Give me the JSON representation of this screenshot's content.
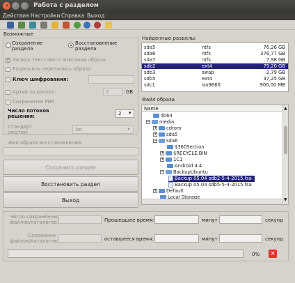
{
  "window": {
    "title": "Работа с разделом"
  },
  "menu": [
    "Действия",
    "Настройки",
    "Справка",
    "Выход"
  ],
  "toolbar_icons": [
    "save-icon",
    "open-icon",
    "refresh-icon",
    "disk-icon",
    "folder-icon",
    "home-icon",
    "globe-icon",
    "info-icon",
    "exit-icon",
    "pencil-icon"
  ],
  "options": {
    "section_title": "Возможные",
    "radio_save": "Сохранение раздела",
    "radio_save_l1": "Сохранение",
    "radio_save_l2": "раздела",
    "radio_restore_l1": "Восстановление",
    "radio_restore_l2": "раздела",
    "write_desc": "Запись текстового описания образа",
    "allow_overwrite": "Разрешить перезапись образа",
    "encrypt_key": "Ключ шифрования:",
    "archive_split": "Архив за раскол:",
    "split_value": "2",
    "split_unit": "GB",
    "save_pbr": "Сохранение PBR",
    "threads_l1": "Число потоков",
    "threads_l2": "решения:",
    "threads_value": "2",
    "compress_l1": "Стандарт",
    "compress_l2": "сжатия:",
    "compress_value": "lzo",
    "image_name_label": "Имя образа восстановления:"
  },
  "buttons": {
    "save": "Сохранить раздел",
    "restore": "Восстановить раздел",
    "exit": "Выход"
  },
  "partitions": {
    "title": "Найденные разделы:",
    "rows": [
      {
        "name": "sda5",
        "fs": "ntfs",
        "size": "76,26 GB"
      },
      {
        "name": "sda6",
        "fs": "ntfs",
        "size": "376,77 GB"
      },
      {
        "name": "sda7",
        "fs": "ntfs",
        "size": "7,98 GB"
      },
      {
        "name": "sdb2",
        "fs": "ext4",
        "size": "79,20 GB"
      },
      {
        "name": "sdb3",
        "fs": "swap",
        "size": "2,79 GB"
      },
      {
        "name": "sdb5",
        "fs": "ext4",
        "size": "37,25 GB"
      },
      {
        "name": "sdc1",
        "fs": "iso9660",
        "size": "900,00 MB"
      }
    ],
    "selected": "sdb2"
  },
  "files": {
    "title": "Файл образа",
    "column": "Name",
    "rows": [
      {
        "label": "lib64"
      },
      {
        "label": "media"
      },
      {
        "label": "cdrom"
      },
      {
        "label": "sda5"
      },
      {
        "label": "sda6"
      },
      {
        "label": "$360Section"
      },
      {
        "label": "$RECYCLE.BIN"
      },
      {
        "label": "1C1"
      },
      {
        "label": "Android 4.4"
      },
      {
        "label": "BackupUbuntu"
      },
      {
        "label": "Backup 05.04 sdb2-5-4-2015.fsa"
      },
      {
        "label": "Backup 05.04 sdb5-5-4-2015.fsa"
      },
      {
        "label": "Default"
      },
      {
        "label": "Local Storage"
      }
    ]
  },
  "status": {
    "saved_files_l1": "Число сохранённых",
    "saved_files_l2": "файлов/каталогов:",
    "restored_l1": "Сохранено",
    "restored_l2": "файлов/каталогов:",
    "elapsed": "Прошедшее время:",
    "remaining": "оставшееся время:",
    "minutes": "минут",
    "seconds": "секунд",
    "progress_text": "0%"
  },
  "colors": {
    "selection": "#232373",
    "cancel": "#d9382a"
  }
}
